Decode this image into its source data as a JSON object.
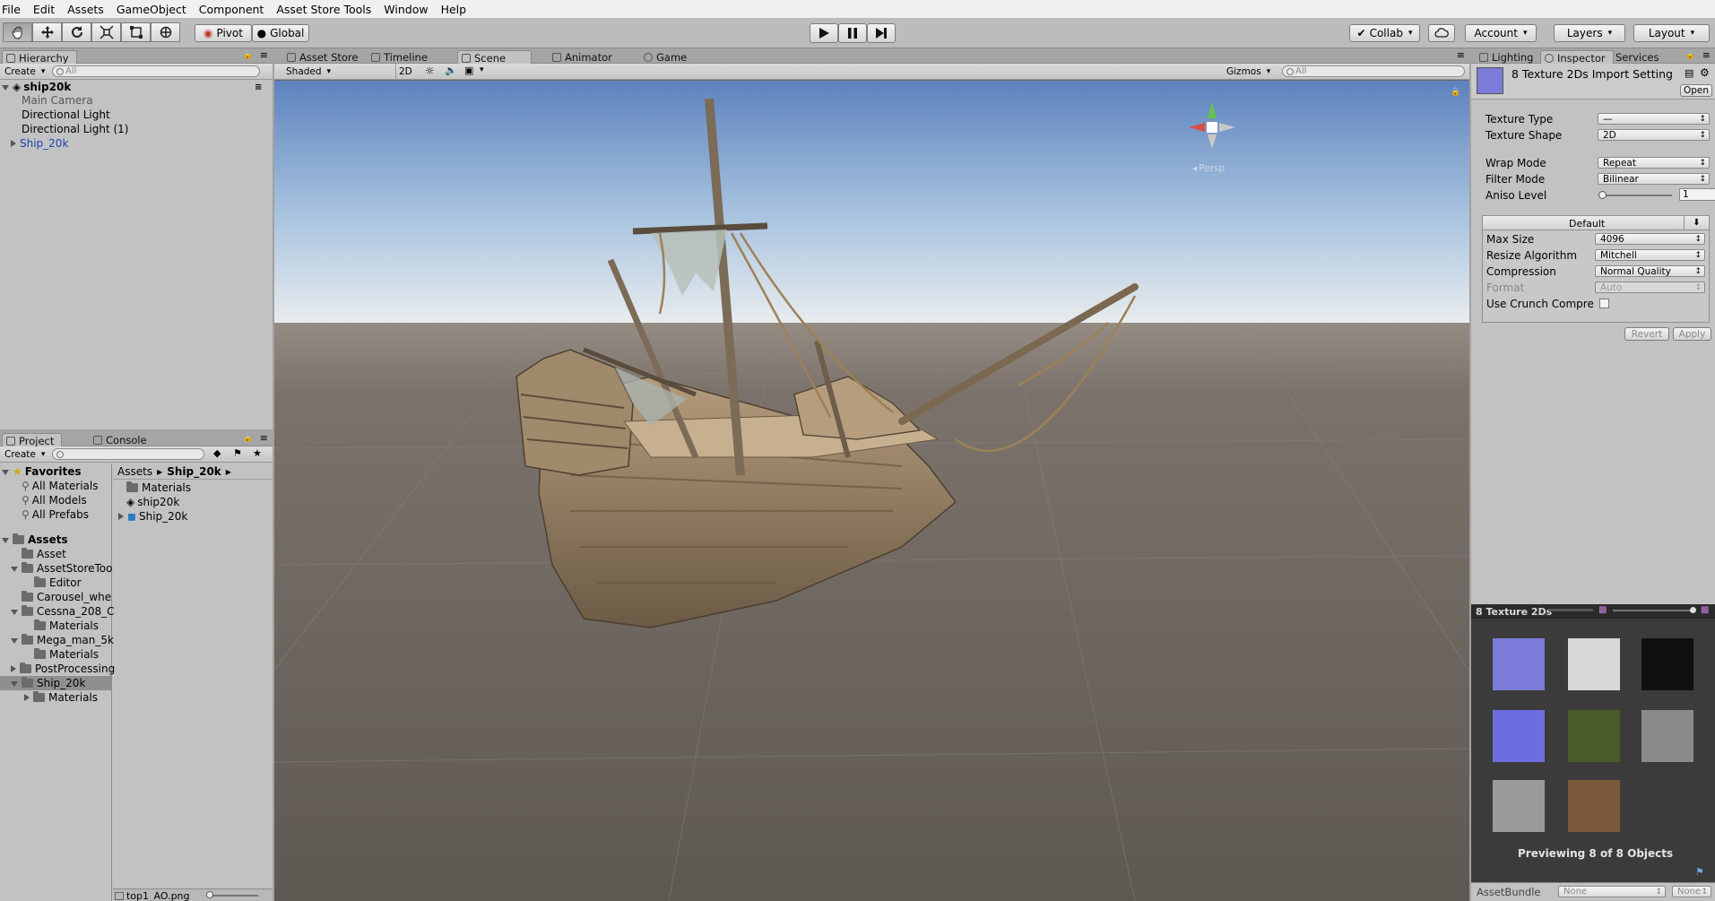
{
  "menu": [
    "File",
    "Edit",
    "Assets",
    "GameObject",
    "Component",
    "Asset Store Tools",
    "Window",
    "Help"
  ],
  "toolbar": {
    "pivot": "Pivot",
    "global": "Global",
    "collab": "Collab",
    "account": "Account",
    "layers": "Layers",
    "layout": "Layout"
  },
  "hierarchy": {
    "tab": "Hierarchy",
    "create": "Create",
    "search_placeholder": "All",
    "scene": "ship20k",
    "items": [
      "Main Camera",
      "Directional Light",
      "Directional Light (1)",
      "Ship_20k"
    ]
  },
  "project": {
    "tab": "Project",
    "console_tab": "Console",
    "create": "Create",
    "favorites": "Favorites",
    "fav_items": [
      "All Materials",
      "All Models",
      "All Prefabs"
    ],
    "assets_root": "Assets",
    "tree": [
      "Asset",
      "AssetStoreToo",
      "Editor",
      "Carousel_whe",
      "Cessna_208_C",
      "Materials",
      "Mega_man_5k",
      "Materials",
      "PostProcessing",
      "Ship_20k",
      "Materials"
    ],
    "breadcrumb_root": "Assets",
    "breadcrumb_current": "Ship_20k",
    "files": [
      "Materials",
      "ship20k",
      "Ship_20k"
    ],
    "status_file": "top1_AO.png"
  },
  "scene": {
    "tabs": [
      "Asset Store",
      "Timeline",
      "Scene",
      "Animator",
      "Game"
    ],
    "shading": "Shaded",
    "mode_2d": "2D",
    "gizmos": "Gizmos",
    "search_placeholder": "All",
    "persp": "Persp"
  },
  "inspector": {
    "tabs": [
      "Lighting",
      "Inspector",
      "Services"
    ],
    "title": "8 Texture 2Ds Import Setting",
    "open": "Open",
    "texture_type_label": "Texture Type",
    "texture_type_value": "—",
    "texture_shape_label": "Texture Shape",
    "texture_shape_value": "2D",
    "wrap_label": "Wrap Mode",
    "wrap_value": "Repeat",
    "filter_label": "Filter Mode",
    "filter_value": "Bilinear",
    "aniso_label": "Aniso Level",
    "aniso_value": "1",
    "default_tab": "Default",
    "max_size_label": "Max Size",
    "max_size_value": "4096",
    "resize_label": "Resize Algorithm",
    "resize_value": "Mitchell",
    "compression_label": "Compression",
    "compression_value": "Normal Quality",
    "format_label": "Format",
    "format_value": "Auto",
    "crunch_label": "Use Crunch Compre",
    "revert": "Revert",
    "apply": "Apply"
  },
  "preview": {
    "title": "8 Texture 2Ds",
    "caption": "Previewing 8 of 8 Objects",
    "assetbundle_label": "AssetBundle",
    "assetbundle_value": "None",
    "variant_value": "None",
    "thumbs": [
      "#7b7bd9",
      "#d8d8d8",
      "#101010",
      "#6d6de0",
      "#4a5a28",
      "#8a8a8a",
      "#9a9a9a",
      "#7a5a3a"
    ]
  }
}
